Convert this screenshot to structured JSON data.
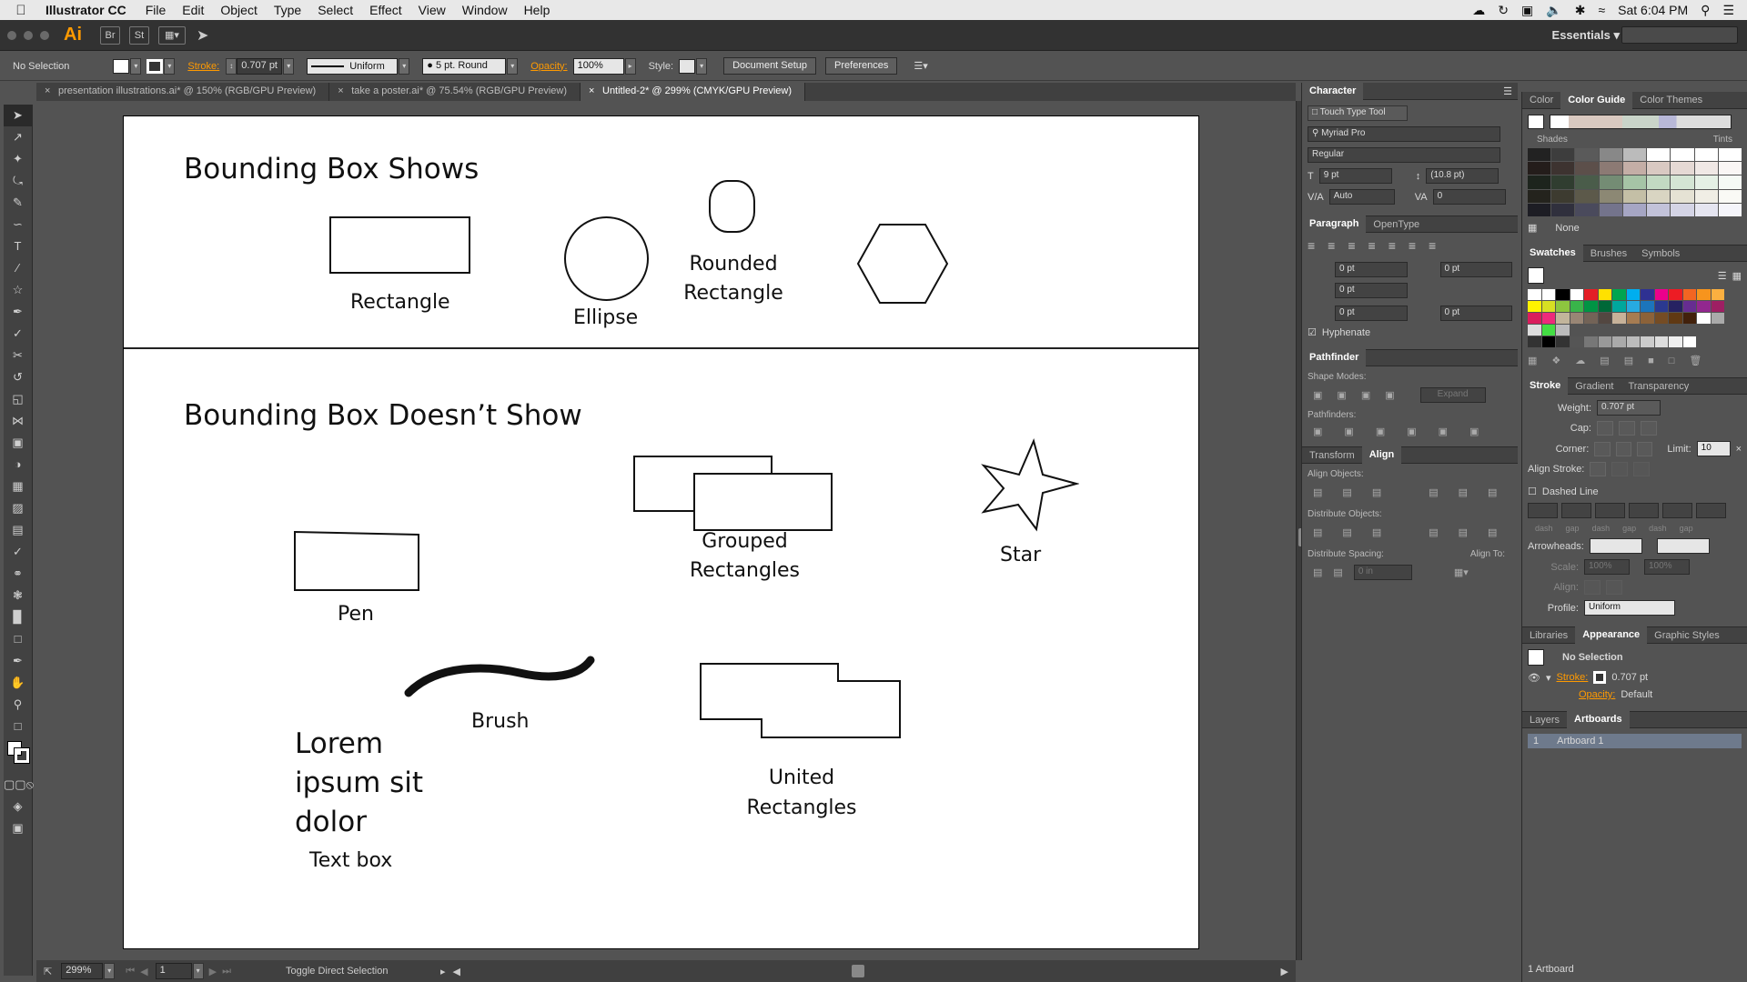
{
  "menubar": {
    "app_name": "Illustrator CC",
    "menus": [
      "File",
      "Edit",
      "Object",
      "Type",
      "Select",
      "Effect",
      "View",
      "Window",
      "Help"
    ],
    "clock": "Sat 6:04 PM"
  },
  "appbar": {
    "logo": "Ai",
    "br": "Br",
    "st": "St",
    "workspace": "Essentials"
  },
  "control": {
    "selection": "No Selection",
    "stroke_label": "Stroke:",
    "stroke_value": "0.707 pt",
    "profile": "Uniform",
    "brush": "5 pt. Round",
    "opacity_label": "Opacity:",
    "opacity_value": "100%",
    "style_label": "Style:",
    "doc_setup": "Document Setup",
    "preferences": "Preferences"
  },
  "tabs": [
    {
      "label": "presentation illustrations.ai* @ 150% (RGB/GPU Preview)",
      "close": "×"
    },
    {
      "label": "take a poster.ai* @ 75.54% (RGB/GPU Preview)",
      "close": "×"
    },
    {
      "label": "Untitled-2* @ 299% (CMYK/GPU Preview)",
      "close": "×"
    }
  ],
  "artboard": {
    "heading_top": "Bounding Box Shows",
    "heading_bottom": "Bounding Box Doesn’t Show",
    "rectangle": "Rectangle",
    "ellipse": "Ellipse",
    "rounded_rect_1": "Rounded",
    "rounded_rect_2": "Rectangle",
    "grouped_1": "Grouped",
    "grouped_2": "Rectangles",
    "star": "Star",
    "pen": "Pen",
    "brush": "Brush",
    "lorem_1": "Lorem",
    "lorem_2": "ipsum sit",
    "lorem_3": "dolor",
    "text_box": "Text box",
    "united_1": "United",
    "united_2": "Rectangles"
  },
  "status": {
    "zoom": "299%",
    "page": "1",
    "info": "Toggle Direct Selection"
  },
  "character": {
    "title": "Character",
    "touch_type": "Touch Type Tool",
    "font": "Myriad Pro",
    "style": "Regular",
    "size": "9 pt",
    "leading": "(10.8 pt)",
    "kerning": "Auto",
    "tracking": "0"
  },
  "paragraph": {
    "tab1": "Paragraph",
    "tab2": "OpenType",
    "indent_left": "0 pt",
    "indent_right": "0 pt",
    "first": "0 pt",
    "space_before": "0 pt",
    "space_after": "0 pt",
    "hyphenate": "Hyphenate"
  },
  "pathfinder": {
    "title": "Pathfinder",
    "shape_modes": "Shape Modes:",
    "expand": "Expand",
    "pathfinders": "Pathfinders:"
  },
  "align": {
    "tab1": "Transform",
    "tab2": "Align",
    "objects": "Align Objects:",
    "distribute": "Distribute Objects:",
    "spacing": "Distribute Spacing:",
    "align_to": "Align To:",
    "spacing_value": "0 in"
  },
  "colorguide": {
    "tabs": [
      "Color",
      "Color Guide",
      "Color Themes"
    ],
    "shades": "Shades",
    "tints": "Tints",
    "none": "None"
  },
  "swatches": {
    "tabs": [
      "Swatches",
      "Brushes",
      "Symbols"
    ]
  },
  "stroke": {
    "tabs": [
      "Stroke",
      "Gradient",
      "Transparency"
    ],
    "weight_label": "Weight:",
    "weight": "0.707 pt",
    "cap": "Cap:",
    "corner": "Corner:",
    "limit_label": "Limit:",
    "limit": "10",
    "align_stroke": "Align Stroke:",
    "dashed": "Dashed Line",
    "dash_labels": [
      "dash",
      "gap",
      "dash",
      "gap",
      "dash",
      "gap"
    ],
    "arrowheads": "Arrowheads:",
    "scale": "Scale:",
    "scale1": "100%",
    "scale2": "100%",
    "align": "Align:",
    "profile_label": "Profile:",
    "profile": "Uniform"
  },
  "appearance": {
    "tabs": [
      "Libraries",
      "Appearance",
      "Graphic Styles"
    ],
    "selection": "No Selection",
    "stroke_label": "Stroke:",
    "stroke_value": "0.707 pt",
    "opacity_label": "Opacity:",
    "opacity_value": "Default"
  },
  "artboards_panel": {
    "tabs": [
      "Layers",
      "Artboards"
    ],
    "row_index": "1",
    "row_name": "Artboard 1",
    "footer": "1 Artboard"
  },
  "colors": {
    "accent": "#ff9a00",
    "panel": "#535353",
    "dark": "#424242"
  }
}
